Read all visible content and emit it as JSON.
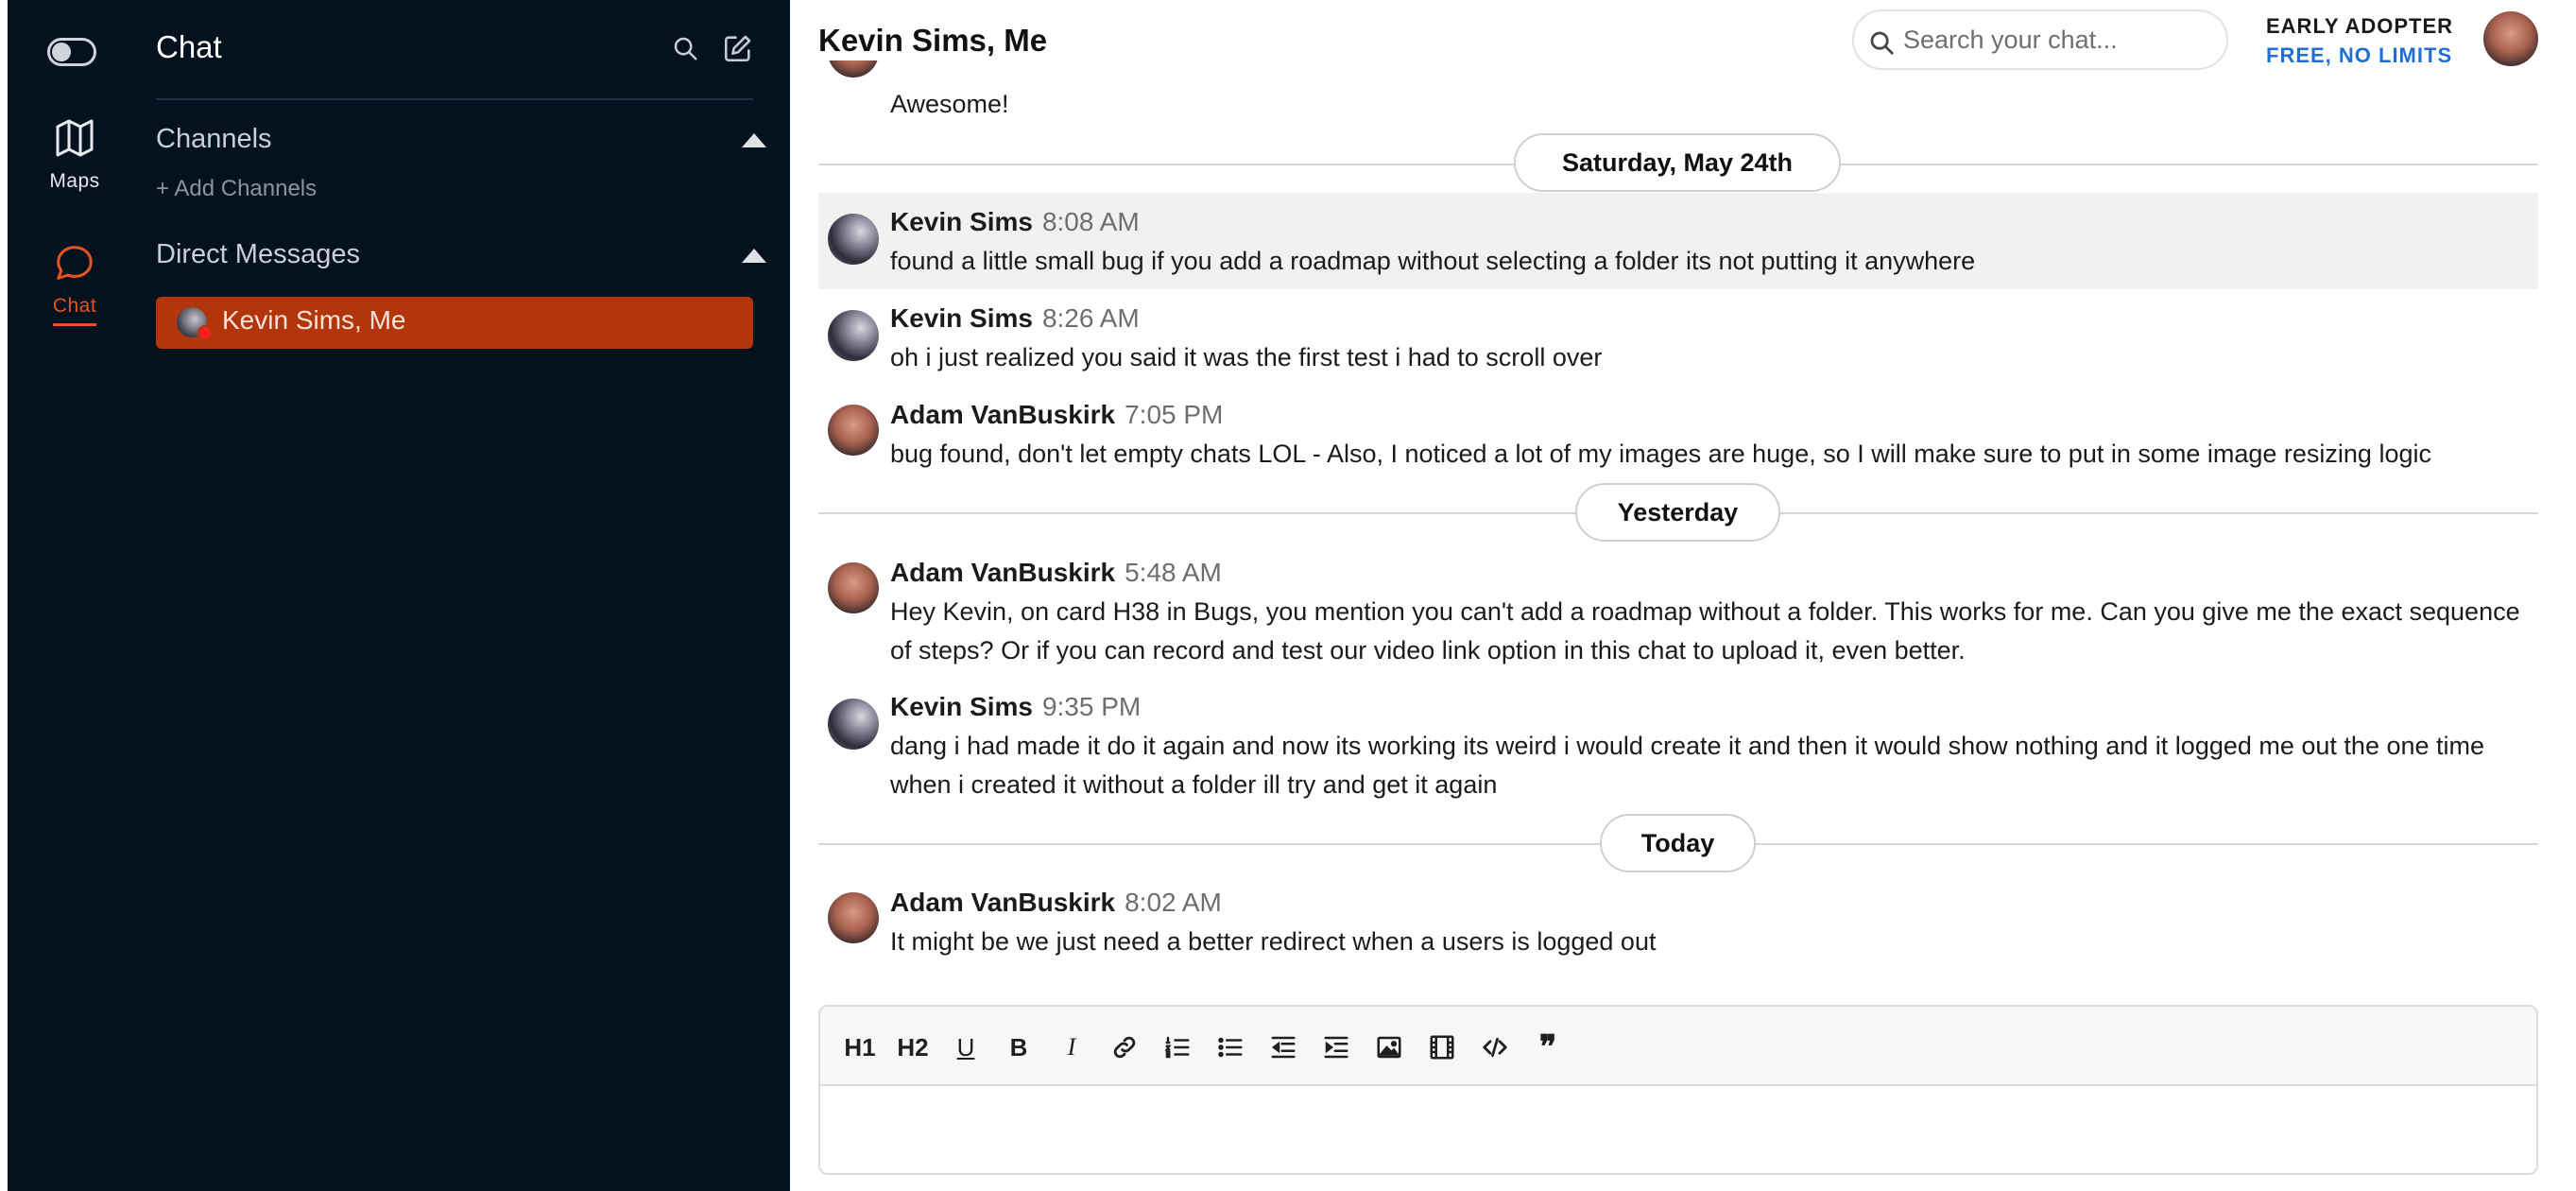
{
  "rail": {
    "maps_label": "Maps",
    "chat_label": "Chat"
  },
  "sidebar": {
    "title": "Chat",
    "channels_label": "Channels",
    "add_channels_label": "+ Add Channels",
    "direct_messages_label": "Direct Messages",
    "dm_items": [
      {
        "label": "Kevin Sims, Me"
      }
    ]
  },
  "header": {
    "title": "Kevin Sims, Me",
    "search_placeholder": "Search your chat...",
    "plan_line1": "EARLY ADOPTER",
    "plan_line2": "FREE, NO LIMITS"
  },
  "messages": {
    "partial_text": "Awesome!",
    "dates": [
      "Saturday, May 24th",
      "Yesterday",
      "Today"
    ],
    "items": [
      {
        "name": "Kevin Sims",
        "time": "8:08 AM",
        "text": "found a little small bug if you add a roadmap without selecting a folder its not putting it anywhere"
      },
      {
        "name": "Kevin Sims",
        "time": "8:26 AM",
        "text": "oh i just realized you said it was the first test i had to scroll over"
      },
      {
        "name": "Adam VanBuskirk",
        "time": "7:05 PM",
        "text": "bug found, don't let empty chats LOL - Also, I noticed a lot of my images are huge, so I will make sure to put in some image resizing logic"
      },
      {
        "name": "Adam VanBuskirk",
        "time": "5:48 AM",
        "text": "Hey Kevin, on card H38 in Bugs, you mention you can't add a roadmap without a folder. This works for me. Can you give me the exact sequence of steps? Or if you can record and test our video link option in this chat to upload it, even better."
      },
      {
        "name": "Kevin Sims",
        "time": "9:35 PM",
        "text": "dang i had made it do it again and now its working its weird i would create it and then it would show nothing and it logged me out the one time when i created it without a folder ill try and get it again"
      },
      {
        "name": "Adam VanBuskirk",
        "time": "8:02 AM",
        "text": "It might be we just need a better redirect when a users is logged out"
      }
    ]
  },
  "editor": {
    "toolbar": {
      "h1": "H1",
      "h2": "H2",
      "underline": "U",
      "bold": "B",
      "italic": "I",
      "quote": "❞"
    }
  },
  "colors": {
    "sidebar_bg": "#04111f",
    "accent": "#e2551e",
    "active_dm_bg": "#b3360b",
    "link_blue": "#1f6fd6"
  }
}
